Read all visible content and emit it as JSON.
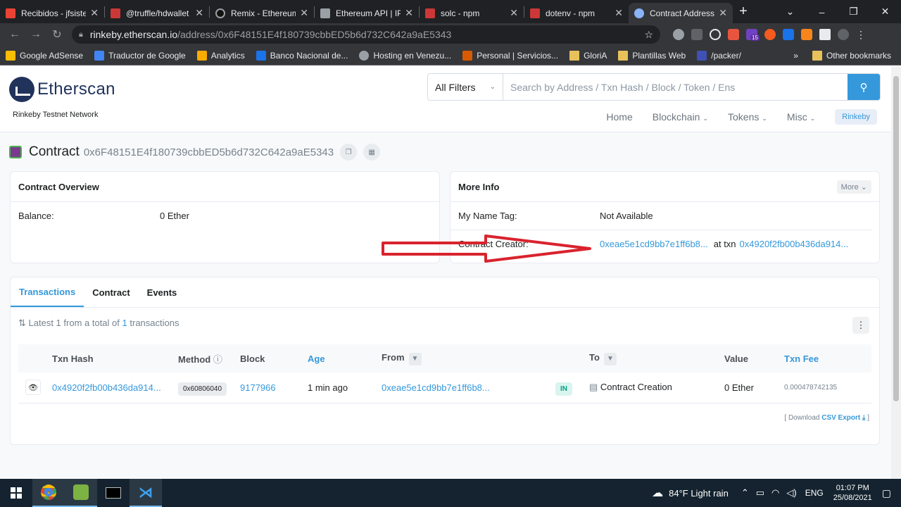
{
  "browser": {
    "tabs": [
      {
        "label": "Recibidos - jfsiste",
        "icon": "gmail-icon",
        "color": "#ea4335"
      },
      {
        "label": "@truffle/hdwallet",
        "icon": "npm-icon",
        "color": "#cb3837"
      },
      {
        "label": "Remix - Ethereum",
        "icon": "remix-icon",
        "color": "#9aa0a6"
      },
      {
        "label": "Ethereum API | IP",
        "icon": "infura-icon",
        "color": "#9aa0a6"
      },
      {
        "label": "solc - npm",
        "icon": "npm-icon",
        "color": "#cb3837"
      },
      {
        "label": "dotenv - npm",
        "icon": "npm-icon",
        "color": "#cb3837"
      },
      {
        "label": "Contract Address",
        "icon": "etherscan-icon",
        "color": "#8ab4f8",
        "active": true
      }
    ],
    "url_host": "rinkeby.etherscan.io",
    "url_path": "/address/0x6F48151E4f180739cbbED5b6d732C642a9aE5343",
    "bookmarks": [
      {
        "label": "Google AdSense",
        "color": "#fbbc04"
      },
      {
        "label": "Traductor de Google",
        "color": "#4285f4"
      },
      {
        "label": "Analytics",
        "color": "#f9ab00"
      },
      {
        "label": "Banco Nacional de...",
        "color": "#1a73e8"
      },
      {
        "label": "Hosting en Venezu...",
        "color": "#9aa0a6"
      },
      {
        "label": "Personal | Servicios...",
        "color": "#d85a00"
      },
      {
        "label": "GloriA",
        "folder": true
      },
      {
        "label": "Plantillas Web",
        "folder": true
      },
      {
        "label": "/packer/",
        "color": "#3f51b5"
      }
    ],
    "other_bookmarks": "Other bookmarks",
    "ext_badge": "15"
  },
  "header": {
    "logo": "Etherscan",
    "network": "Rinkeby Testnet Network",
    "filter": "All Filters",
    "search_placeholder": "Search by Address / Txn Hash / Block / Token / Ens",
    "menu": [
      "Home",
      "Blockchain",
      "Tokens",
      "Misc"
    ],
    "network_button": "Rinkeby"
  },
  "contract": {
    "label": "Contract",
    "address": "0x6F48151E4f180739cbbED5b6d732C642a9aE5343"
  },
  "overview": {
    "title": "Contract Overview",
    "balance_label": "Balance:",
    "balance_value": "0 Ether"
  },
  "moreinfo": {
    "title": "More Info",
    "more_button": "More",
    "name_tag_label": "My Name Tag:",
    "name_tag_value": "Not Available",
    "creator_label": "Contract Creator:",
    "creator_address": "0xeae5e1cd9bb7e1ff6b8...",
    "at_txn": "at txn",
    "creator_txn": "0x4920f2fb00b436da914..."
  },
  "tabs": [
    "Transactions",
    "Contract",
    "Events"
  ],
  "transactions": {
    "summary_prefix": "Latest 1 from a total of",
    "total": "1",
    "summary_suffix": "transactions",
    "columns": [
      "Txn Hash",
      "Method",
      "Block",
      "Age",
      "From",
      "To",
      "Value",
      "Txn Fee"
    ],
    "rows": [
      {
        "hash": "0x4920f2fb00b436da914...",
        "method": "0x60806040",
        "block": "9177966",
        "age": "1 min ago",
        "from": "0xeae5e1cd9bb7e1ff6b8...",
        "direction": "IN",
        "to": "Contract Creation",
        "value": "0 Ether",
        "fee": "0.000478742135"
      }
    ],
    "download_prefix": "[ Download",
    "download_link": "CSV Export",
    "download_suffix": "]"
  },
  "taskbar": {
    "weather": "84°F  Light rain",
    "lang": "ENG",
    "time": "01:07 PM",
    "date": "25/08/2021"
  }
}
